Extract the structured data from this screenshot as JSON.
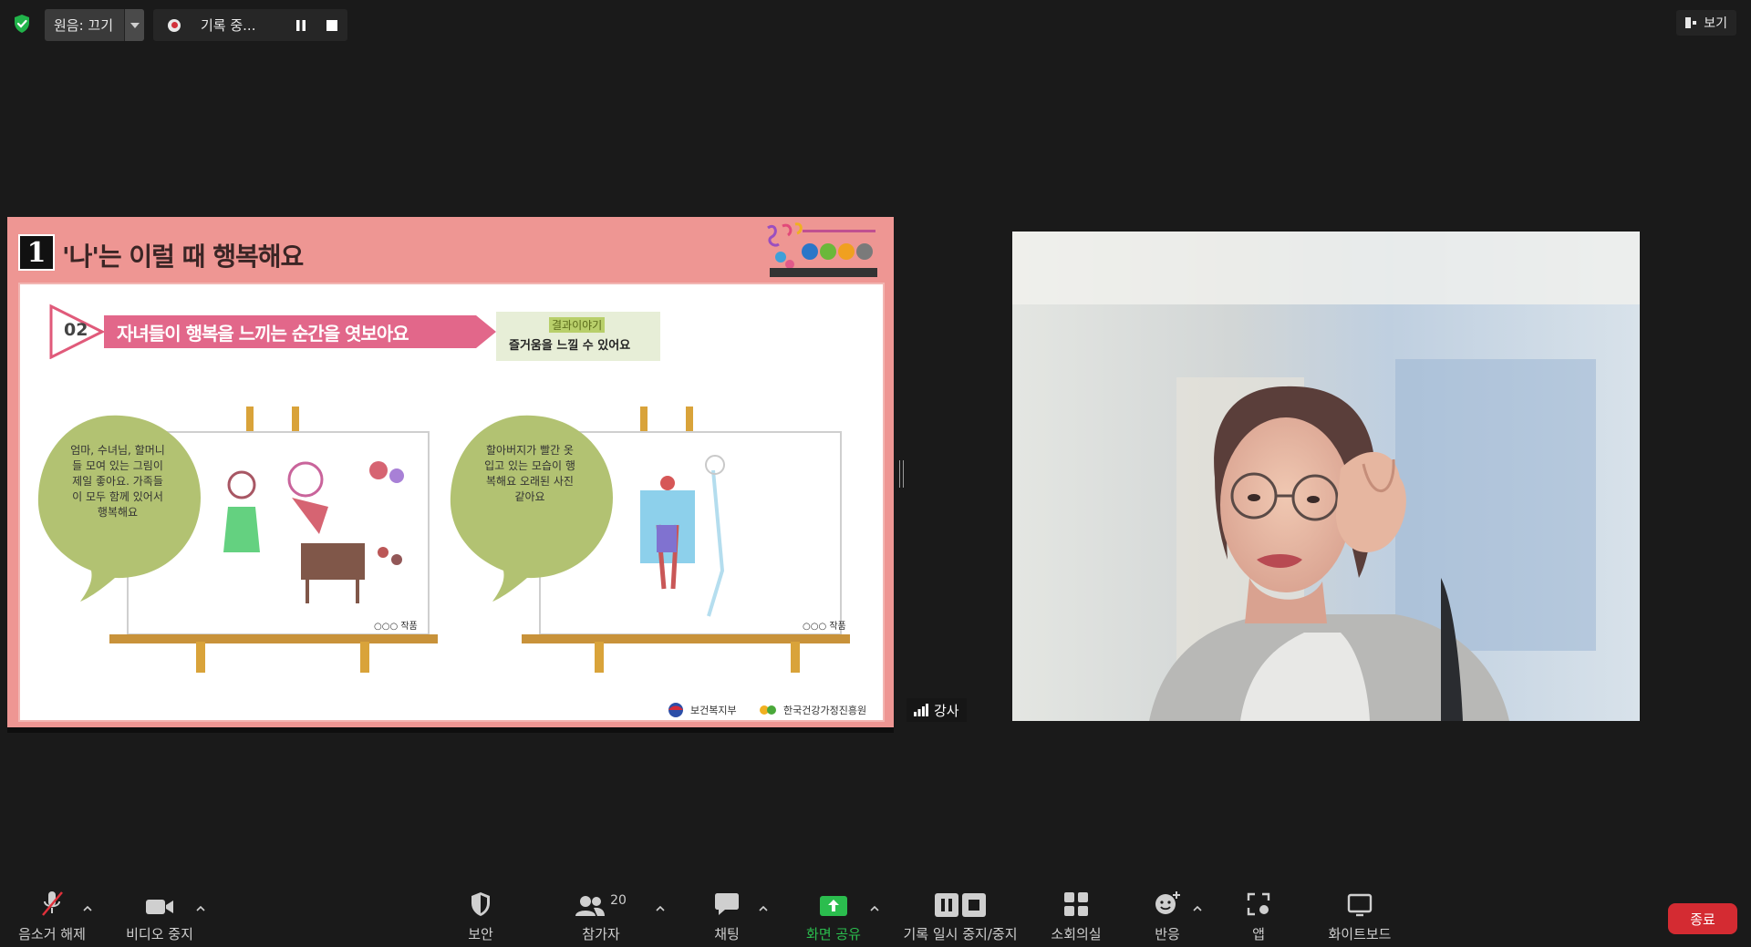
{
  "topbar": {
    "audio_label": "원음: 끄기",
    "recording_label": "기록 중...",
    "view_label": "보기"
  },
  "slide": {
    "number": "1",
    "title": "'나'는 이럴 때 행복해요",
    "banner_num": "02",
    "banner_text": "자녀들이 행복을 느끼는 순간을 엿보아요",
    "note_tag": "결과이야기",
    "note_text": "즐거움을 느낄 수 있어요",
    "bubble_left": "엄마, 수녀님, 할머니들 모여 있는 그림이 제일 좋아요. 가족들이 모두 함께 있어서 행복해요",
    "bubble_right": "할아버지가 빨간 옷 입고 있는 모습이 행복해요 오래된 사진 같아요",
    "caption_left": "○○○ 작품",
    "caption_right": "○○○ 작품",
    "footer_left": "보건복지부",
    "footer_right": "한국건강가정진흥원"
  },
  "participant": {
    "name": "강사"
  },
  "toolbar": {
    "mute_label": "음소거 해제",
    "video_label": "비디오 중지",
    "security_label": "보안",
    "participants_label": "참가자",
    "participants_count": "20",
    "chat_label": "채팅",
    "share_label": "화면 공유",
    "record_label": "기록 일시 중지/중지",
    "breakout_label": "소회의실",
    "reactions_label": "반응",
    "apps_label": "앱",
    "whiteboard_label": "화이트보드",
    "end_label": "종료"
  },
  "colors": {
    "share_green": "#2bbd4e",
    "end_red": "#d42b32",
    "slide_pink": "#ee9693"
  }
}
